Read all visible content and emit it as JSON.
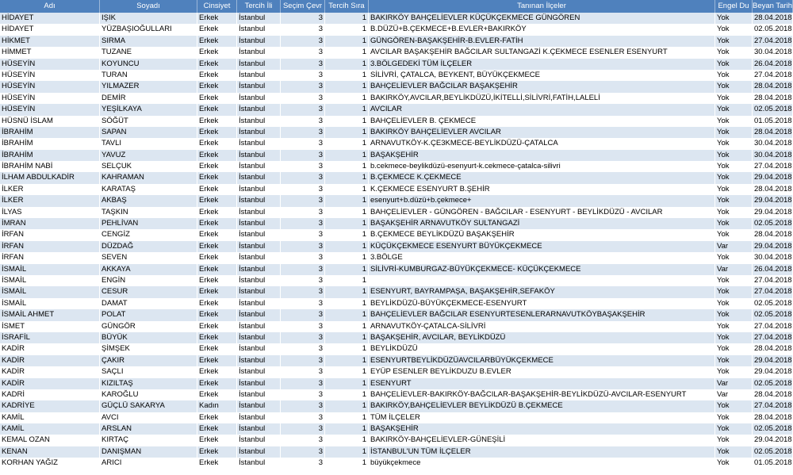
{
  "columns": [
    "Adı",
    "Soyadı",
    "Cinsiyet",
    "Tercih İli",
    "Seçim Çevr",
    "Tercih Sıra",
    "Tanınan İlçeler",
    "Engel Du",
    "Beyan Tarihi"
  ],
  "rows": [
    [
      "HİDAYET",
      "IŞIK",
      "Erkek",
      "İstanbul",
      "3",
      "1",
      "BAKIRKÖY BAHÇELİEVLER KÜÇÜKÇEKMECE GÜNGÖREN",
      "Yok",
      "28.04.2018"
    ],
    [
      "HİDAYET",
      "YÜZBAŞIOĞULLARI",
      "Erkek",
      "İstanbul",
      "3",
      "1",
      "B.DÜZÜ+B.ÇEKMECE+B.EVLER+BAKIRKÖY",
      "Yok",
      "02.05.2018"
    ],
    [
      "HİKMET",
      "SIRMA",
      "Erkek",
      "İstanbul",
      "3",
      "1",
      "GÜNGÖREN-BAŞAKŞEHİR-B.EVLER-FATİH",
      "Yok",
      "27.04.2018"
    ],
    [
      "HİMMET",
      "TUZANE",
      "Erkek",
      "İstanbul",
      "3",
      "1",
      "AVCILAR BAŞAKŞEHİR BAĞCILAR SULTANGAZİ K.ÇEKMECE ESENLER ESENYURT",
      "Yok",
      "30.04.2018"
    ],
    [
      "HÜSEYİN",
      "KOYUNCU",
      "Erkek",
      "İstanbul",
      "3",
      "1",
      "3.BÖLGEDEKİ TÜM İLÇELER",
      "Yok",
      "26.04.2018"
    ],
    [
      "HÜSEYİN",
      "TURAN",
      "Erkek",
      "İstanbul",
      "3",
      "1",
      "SİLİVRİ, ÇATALCA, BEYKENT, BÜYÜKÇEKMECE",
      "Yok",
      "27.04.2018"
    ],
    [
      "HÜSEYİN",
      "YILMAZER",
      "Erkek",
      "İstanbul",
      "3",
      "1",
      "BAHÇELİEVLER BAĞCILAR BAŞAKŞEHİR",
      "Yok",
      "28.04.2018"
    ],
    [
      "HÜSEYİN",
      "DEMİR",
      "Erkek",
      "İstanbul",
      "3",
      "1",
      "BAKIRKÖY,AVCILAR,BEYLİKDÜZÜ,İKİTELLİ,SİLİVRİ,FATİH,LALELİ",
      "Yok",
      "28.04.2018"
    ],
    [
      "HÜSEYİN",
      "YEŞİLKAYA",
      "Erkek",
      "İstanbul",
      "3",
      "1",
      "AVCILAR",
      "Yok",
      "02.05.2018"
    ],
    [
      "HÜSNÜ İSLAM",
      "SÖĞÜT",
      "Erkek",
      "İstanbul",
      "3",
      "1",
      "BAHÇELİEVLER B. ÇEKMECE",
      "Yok",
      "01.05.2018"
    ],
    [
      "İBRAHİM",
      "SAPAN",
      "Erkek",
      "İstanbul",
      "3",
      "1",
      "BAKIRKÖY BAHÇELİEVLER AVCILAR",
      "Yok",
      "28.04.2018"
    ],
    [
      "İBRAHİM",
      "TAVLI",
      "Erkek",
      "İstanbul",
      "3",
      "1",
      "ARNAVUTKÖY-K.ÇE3KMECE-BEYLİKDÜZÜ-ÇATALCA",
      "Yok",
      "30.04.2018"
    ],
    [
      "İBRAHİM",
      "YAVUZ",
      "Erkek",
      "İstanbul",
      "3",
      "1",
      "BAŞAKŞEHİR",
      "Yok",
      "30.04.2018"
    ],
    [
      "İBRAHİM NABİ",
      "SELÇUK",
      "Erkek",
      "İstanbul",
      "3",
      "1",
      "b.cekmece-beylikdüzü-esenyurt-k.cekmece-çatalca-silivri",
      "Yok",
      "27.04.2018"
    ],
    [
      "İLHAM ABDULKADİR",
      "KAHRAMAN",
      "Erkek",
      "İstanbul",
      "3",
      "1",
      "B.ÇEKMECE K.ÇEKMECE",
      "Yok",
      "29.04.2018"
    ],
    [
      "İLKER",
      "KARATAŞ",
      "Erkek",
      "İstanbul",
      "3",
      "1",
      "K.ÇEKMECE ESENYURT B.ŞEHİR",
      "Yok",
      "28.04.2018"
    ],
    [
      "İLKER",
      "AKBAŞ",
      "Erkek",
      "İstanbul",
      "3",
      "1",
      "esenyurt+b.düzü+b.çekmece+",
      "Yok",
      "29.04.2018"
    ],
    [
      "İLYAS",
      "TAŞKIN",
      "Erkek",
      "İstanbul",
      "3",
      "1",
      "BAHÇELİEVLER - GÜNGÖREN - BAĞCILAR - ESENYURT - BEYLİKDÜZÜ - AVCILAR",
      "Yok",
      "29.04.2018"
    ],
    [
      "İMRAN",
      "PEHLİVAN",
      "Erkek",
      "İstanbul",
      "3",
      "1",
      "BAŞAKŞEHİR ARNAVUTKÖY SULTANGAZİ",
      "Yok",
      "02.05.2018"
    ],
    [
      "İRFAN",
      "CENGİZ",
      "Erkek",
      "İstanbul",
      "3",
      "1",
      "B.ÇEKMECE BEYLİKDÜZÜ BAŞAKŞEHİR",
      "Yok",
      "28.04.2018"
    ],
    [
      "İRFAN",
      "DÜZDAĞ",
      "Erkek",
      "İstanbul",
      "3",
      "1",
      "KÜÇÜKÇEKMECE ESENYURT BÜYÜKÇEKMECE",
      "Var",
      "29.04.2018"
    ],
    [
      "İRFAN",
      "SEVEN",
      "Erkek",
      "İstanbul",
      "3",
      "1",
      "3.BÖLGE",
      "Yok",
      "30.04.2018"
    ],
    [
      "İSMAİL",
      "AKKAYA",
      "Erkek",
      "İstanbul",
      "3",
      "1",
      "SİLİVRİ-KUMBURGAZ-BÜYÜKÇEKMECE- KÜÇÜKÇEKMECE",
      "Var",
      "26.04.2018"
    ],
    [
      "İSMAİL",
      "ENGİN",
      "Erkek",
      "İstanbul",
      "3",
      "1",
      "",
      "Yok",
      "27.04.2018"
    ],
    [
      "İSMAİL",
      "CESUR",
      "Erkek",
      "İstanbul",
      "3",
      "1",
      "ESENYURT, BAYRAMPAŞA, BAŞAKŞEHİR,SEFAKÖY",
      "Yok",
      "27.04.2018"
    ],
    [
      "İSMAİL",
      "DAMAT",
      "Erkek",
      "İstanbul",
      "3",
      "1",
      "BEYLİKDÜZÜ-BÜYÜKÇEKMECE-ESENYURT",
      "Yok",
      "02.05.2018"
    ],
    [
      "İSMAİL AHMET",
      "POLAT",
      "Erkek",
      "İstanbul",
      "3",
      "1",
      "BAHÇELİEVLER BAĞCILAR ESENYURTESENLERARNAVUTKÖYBAŞAKŞEHİR",
      "Yok",
      "02.05.2018"
    ],
    [
      "İSMET",
      "GÜNGÖR",
      "Erkek",
      "İstanbul",
      "3",
      "1",
      "ARNAVUTKÖY-ÇATALCA-SİLİVRİ",
      "Yok",
      "27.04.2018"
    ],
    [
      "İSRAFİL",
      "BÜYÜK",
      "Erkek",
      "İstanbul",
      "3",
      "1",
      "BAŞAKŞEHİR, AVCILAR, BEYLİKDÜZÜ",
      "Yok",
      "27.04.2018"
    ],
    [
      "KADİR",
      "ŞİMŞEK",
      "Erkek",
      "İstanbul",
      "3",
      "1",
      "BEYLİKDÜZÜ",
      "Yok",
      "28.04.2018"
    ],
    [
      "KADİR",
      "ÇAKIR",
      "Erkek",
      "İstanbul",
      "3",
      "1",
      "ESENYURTBEYLİKDÜZÜAVCILARBÜYÜKÇEKMECE",
      "Yok",
      "29.04.2018"
    ],
    [
      "KADİR",
      "SAÇLI",
      "Erkek",
      "İstanbul",
      "3",
      "1",
      "EYÜP ESENLER BEYLİKDUZU B.EVLER",
      "Yok",
      "29.04.2018"
    ],
    [
      "KADİR",
      "KIZILTAŞ",
      "Erkek",
      "İstanbul",
      "3",
      "1",
      "ESENYURT",
      "Var",
      "02.05.2018"
    ],
    [
      "KADRİ",
      "KAROĞLU",
      "Erkek",
      "İstanbul",
      "3",
      "1",
      "BAHÇELİEVLER-BAKIRKÖY-BAĞCILAR-BAŞAKŞEHİR-BEYLİKDÜZÜ-AVCILAR-ESENYURT",
      "Var",
      "28.04.2018"
    ],
    [
      "KADRİYE",
      "GÜÇLÜ SAKARYA",
      "Kadın",
      "İstanbul",
      "3",
      "1",
      "BAKIRKÖY,BAHÇELİEVLER BEYLİKDÜZÜ B.ÇEKMECE",
      "Yok",
      "27.04.2018"
    ],
    [
      "KAMİL",
      "AVCI",
      "Erkek",
      "İstanbul",
      "3",
      "1",
      "TÜM İLÇELER",
      "Yok",
      "28.04.2018"
    ],
    [
      "KAMİL",
      "ARSLAN",
      "Erkek",
      "İstanbul",
      "3",
      "1",
      "BAŞAKŞEHİR",
      "Yok",
      "02.05.2018"
    ],
    [
      "KEMAL OZAN",
      "KIRTAÇ",
      "Erkek",
      "İstanbul",
      "3",
      "1",
      "BAKIRKÖY-BAHÇELİEVLER-GÜNEŞİLİ",
      "Yok",
      "29.04.2018"
    ],
    [
      "KENAN",
      "DANIŞMAN",
      "Erkek",
      "İstanbul",
      "3",
      "1",
      "İSTANBUL'UN TÜM İLÇELER",
      "Yok",
      "02.05.2018"
    ],
    [
      "KORHAN YAĞIZ",
      "ARICI",
      "Erkek",
      "İstanbul",
      "3",
      "1",
      "büyükçekmece",
      "Yok",
      "01.05.2018"
    ]
  ]
}
